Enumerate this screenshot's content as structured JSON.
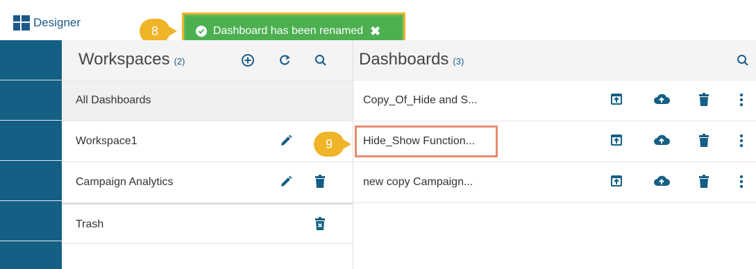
{
  "app": {
    "brand": "Designer"
  },
  "toast": {
    "message": "Dashboard has been renamed",
    "close_symbol": "✖"
  },
  "callouts": [
    {
      "number": "8"
    },
    {
      "number": "9"
    }
  ],
  "workspaces": {
    "title": "Workspaces",
    "count": "(2)",
    "items": [
      {
        "label": "All Dashboards"
      },
      {
        "label": "Workspace1"
      },
      {
        "label": "Campaign Analytics"
      },
      {
        "label": "Trash"
      }
    ]
  },
  "dashboards": {
    "title": "Dashboards",
    "count": "(3)",
    "items": [
      {
        "label": "Copy_Of_Hide and S..."
      },
      {
        "label": "Hide_Show Function..."
      },
      {
        "label": "new copy Campaign..."
      }
    ]
  },
  "colors": {
    "accent": "#145f84",
    "toast": "#4caf50",
    "callout": "#f0b429",
    "highlight": "#e8896b"
  }
}
